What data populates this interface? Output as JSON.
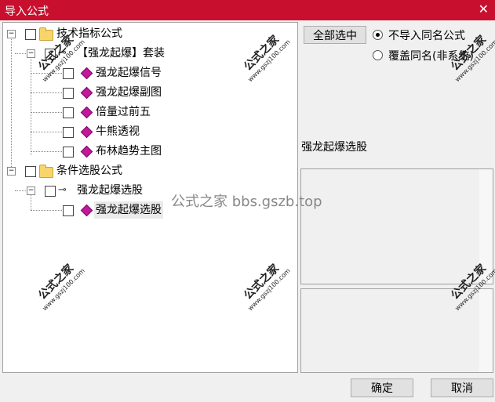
{
  "window": {
    "title": "导入公式",
    "close_glyph": "✕"
  },
  "tree": {
    "groups": [
      {
        "label": "技术指标公式",
        "suite": {
          "label": "【强龙起爆】套装",
          "items": [
            "强龙起爆信号",
            "强龙起爆副图",
            "倍量过前五",
            "牛熊透视",
            "布林趋势主图"
          ]
        }
      },
      {
        "label": "条件选股公式",
        "suite": {
          "label": "强龙起爆选股",
          "items": [
            "强龙起爆选股"
          ]
        }
      }
    ],
    "expanded_glyph": "−"
  },
  "options": {
    "select_all": "全部选中",
    "radio_skip": "不导入同名公式",
    "radio_overwrite": "覆盖同名(非系统)",
    "selected_radio": "skip"
  },
  "detail": {
    "formula_name": "强龙起爆选股"
  },
  "footer": {
    "ok": "确定",
    "cancel": "取消"
  },
  "watermark": {
    "brand": "公式之家",
    "url": "www.gszj100.com",
    "center": "公式之家 bbs.gszb.top"
  },
  "colors": {
    "titlebar": "#c8102e",
    "gem_icon": "#c2189a",
    "folder": "#f7d56a"
  }
}
